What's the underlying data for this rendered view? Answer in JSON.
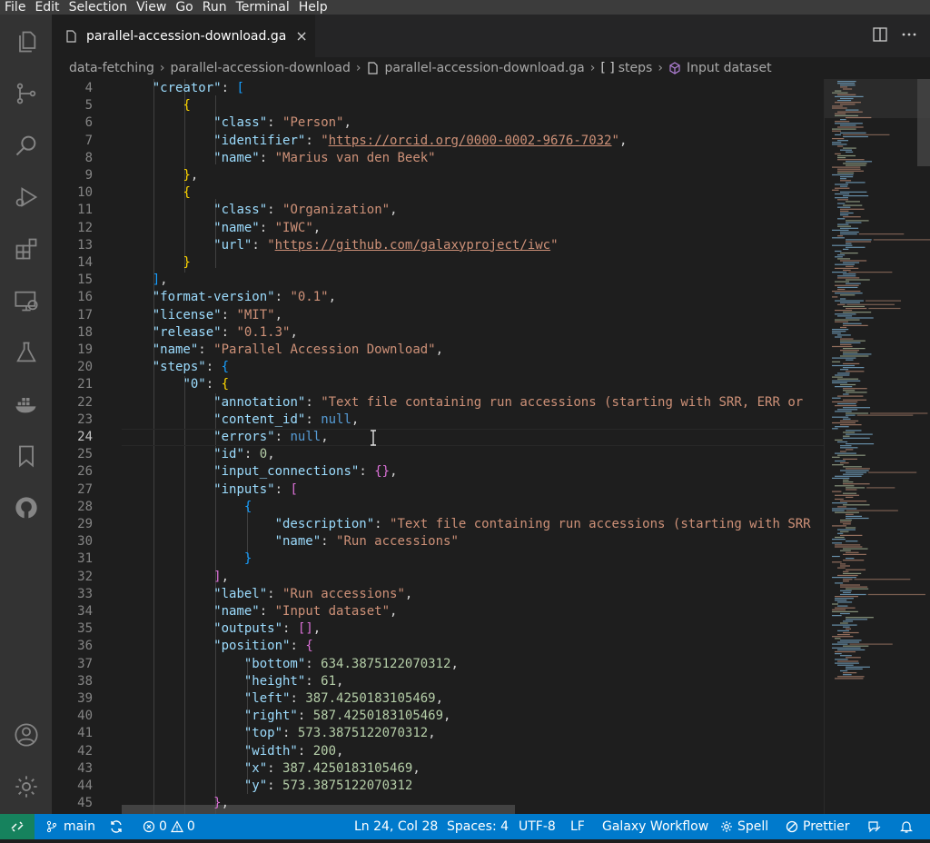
{
  "menu": [
    "File",
    "Edit",
    "Selection",
    "View",
    "Go",
    "Run",
    "Terminal",
    "Help"
  ],
  "activity_bar": {
    "top": [
      "explorer-icon",
      "source-control-icon",
      "search-icon",
      "run-debug-icon",
      "extensions-icon",
      "remote-explorer-icon",
      "testing-icon",
      "docker-icon",
      "bookmarks-icon",
      "github-icon"
    ],
    "bottom": [
      "accounts-icon",
      "manage-gear-icon"
    ]
  },
  "tab": {
    "label": "parallel-accession-download.ga",
    "close": "×"
  },
  "breadcrumbs": {
    "folder": "data-fetching",
    "subfolder": "parallel-accession-download",
    "file": "parallel-accession-download.ga",
    "array": "steps",
    "array_icon": "[ ]",
    "object": "Input dataset"
  },
  "editor": {
    "current_line": 24,
    "lines": [
      [
        4,
        "    \"creator\": ["
      ],
      [
        5,
        "        {"
      ],
      [
        6,
        "            \"class\": \"Person\","
      ],
      [
        7,
        "            \"identifier\": \"https://orcid.org/0000-0002-9676-7032\","
      ],
      [
        8,
        "            \"name\": \"Marius van den Beek\""
      ],
      [
        9,
        "        },"
      ],
      [
        10,
        "        {"
      ],
      [
        11,
        "            \"class\": \"Organization\","
      ],
      [
        12,
        "            \"name\": \"IWC\","
      ],
      [
        13,
        "            \"url\": \"https://github.com/galaxyproject/iwc\""
      ],
      [
        14,
        "        }"
      ],
      [
        15,
        "    ],"
      ],
      [
        16,
        "    \"format-version\": \"0.1\","
      ],
      [
        17,
        "    \"license\": \"MIT\","
      ],
      [
        18,
        "    \"release\": \"0.1.3\","
      ],
      [
        19,
        "    \"name\": \"Parallel Accession Download\","
      ],
      [
        20,
        "    \"steps\": {"
      ],
      [
        21,
        "        \"0\": {"
      ],
      [
        22,
        "            \"annotation\": \"Text file containing run accessions (starting with SRR, ERR or"
      ],
      [
        23,
        "            \"content_id\": null,"
      ],
      [
        24,
        "            \"errors\": null,"
      ],
      [
        25,
        "            \"id\": 0,"
      ],
      [
        26,
        "            \"input_connections\": {},"
      ],
      [
        27,
        "            \"inputs\": ["
      ],
      [
        28,
        "                {"
      ],
      [
        29,
        "                    \"description\": \"Text file containing run accessions (starting with SRR"
      ],
      [
        30,
        "                    \"name\": \"Run accessions\""
      ],
      [
        31,
        "                }"
      ],
      [
        32,
        "            ],"
      ],
      [
        33,
        "            \"label\": \"Run accessions\","
      ],
      [
        34,
        "            \"name\": \"Input dataset\","
      ],
      [
        35,
        "            \"outputs\": [],"
      ],
      [
        36,
        "            \"position\": {"
      ],
      [
        37,
        "                \"bottom\": 634.3875122070312,"
      ],
      [
        38,
        "                \"height\": 61,"
      ],
      [
        39,
        "                \"left\": 387.4250183105469,"
      ],
      [
        40,
        "                \"right\": 587.4250183105469,"
      ],
      [
        41,
        "                \"top\": 573.3875122070312,"
      ],
      [
        42,
        "                \"width\": 200,"
      ],
      [
        43,
        "                \"x\": 387.4250183105469,"
      ],
      [
        44,
        "                \"y\": 573.3875122070312"
      ],
      [
        45,
        "            },"
      ]
    ]
  },
  "status": {
    "branch": "main",
    "errors": "0",
    "warnings": "0",
    "cursor": "Ln 24, Col 28",
    "spaces": "Spaces: 4",
    "encoding": "UTF-8",
    "eol": "LF",
    "language": "Galaxy Workflow",
    "spell": "Spell",
    "prettier": "Prettier"
  },
  "colors": {
    "status_bar": "#007acc",
    "remote": "#16825d",
    "key": "#9cdcfe",
    "string": "#ce9178",
    "number": "#b5cea8",
    "keyword": "#569cd6"
  }
}
